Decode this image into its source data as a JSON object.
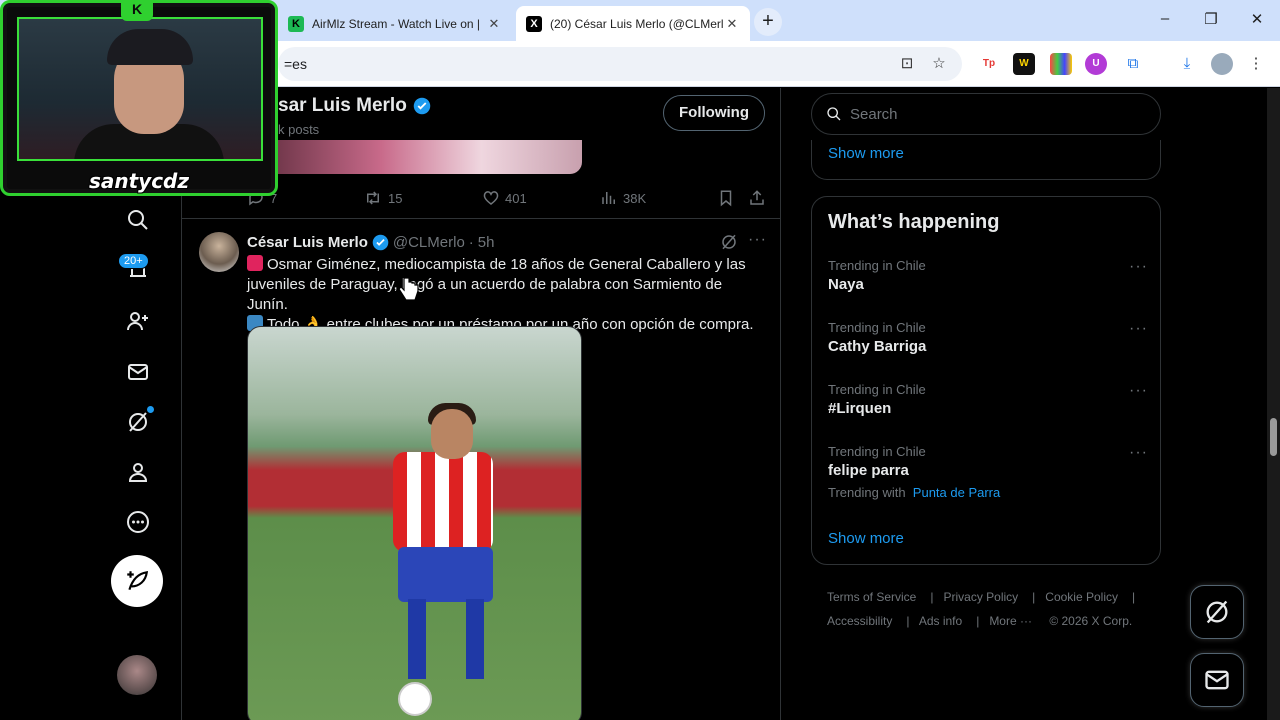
{
  "browser": {
    "tabs": [
      {
        "title": "AirMlz Stream - Watch Live on |",
        "favicon": "K"
      },
      {
        "title": "(20) César Luis Merlo (@CLMerlo",
        "favicon": "X"
      }
    ],
    "new_tab": "+",
    "url": "=es",
    "window_controls": {
      "minimize": "–",
      "maximize": "❐",
      "close": "✕"
    }
  },
  "webcam": {
    "overlay_name": "santycdz",
    "badge": "K"
  },
  "nav": {
    "notifications_badge": "20+"
  },
  "profile_header": {
    "name": "sar Luis Merlo",
    "posts": "k posts",
    "follow_label": "Following"
  },
  "previous_tweet": {
    "replies": "7",
    "reposts": "15",
    "likes": "401",
    "views": "38K"
  },
  "tweet": {
    "name": "César Luis Merlo",
    "handle": "@CLMerlo",
    "separator": "·",
    "time": "5h",
    "line1": "Osmar Giménez, mediocampista de 18 años de General Caballero y las juveniles de Paraguay, llegó a un acuerdo de palabra con Sarmiento de Junín.",
    "line2": "Todo",
    "line2_emoji": "👌",
    "line2_rest": "entre clubes por un préstamo por un año con opción de compra."
  },
  "sidebar": {
    "search_placeholder": "Search",
    "show_more_top": "Show more",
    "whats_happening": "What’s happening",
    "trends": [
      {
        "context": "Trending in Chile",
        "name": "Naya"
      },
      {
        "context": "Trending in Chile",
        "name": "Cathy Barriga"
      },
      {
        "context": "Trending in Chile",
        "name": "#Lirquen"
      },
      {
        "context": "Trending in Chile",
        "name": "felipe parra",
        "with_label": "Trending with",
        "with_value": "Punta de Parra"
      }
    ],
    "more_glyph": "···",
    "show_more_bottom": "Show more"
  },
  "footer": {
    "links": [
      "Terms of Service",
      "Privacy Policy",
      "Cookie Policy",
      "Accessibility",
      "Ads info",
      "More ···"
    ],
    "copyright": "© 2026 X Corp."
  },
  "colors": {
    "accent": "#1d9bf0",
    "webcam_green": "#2fd02f"
  }
}
